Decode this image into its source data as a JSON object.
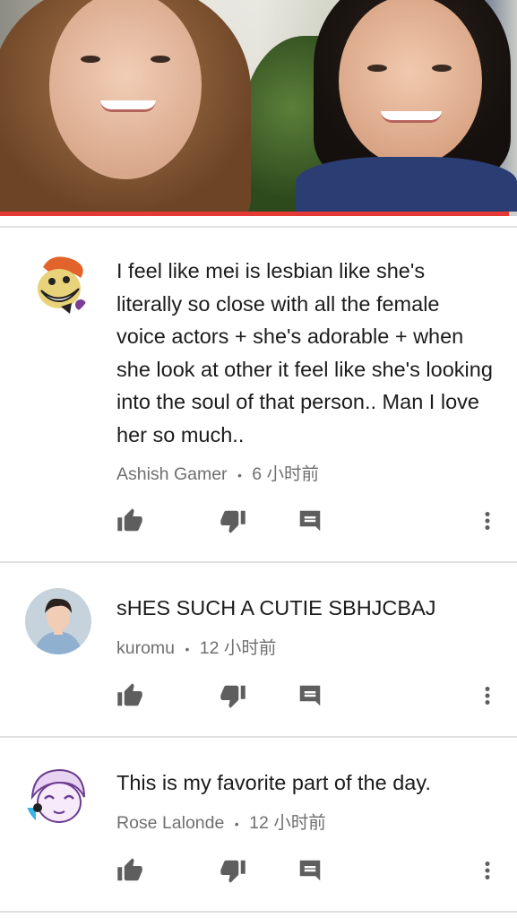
{
  "video": {
    "progress_percent": 98.5,
    "colors": {
      "progress": "#e53935",
      "track": "#cfcfcf"
    }
  },
  "comments": [
    {
      "text": "I feel like mei is lesbian like she's literally so close with all the female voice actors + she's adorable + when she look at other it feel like she's looking into the soul of that person.. Man I love her so much..",
      "author": "Ashish Gamer",
      "separator": "•",
      "time": "6 小时前",
      "avatar": "cartoon-face-avatar"
    },
    {
      "text": "sHES SUCH A CUTIE SBHJCBAJ",
      "author": "kuromu",
      "separator": "•",
      "time": "12 小时前",
      "avatar": "person-photo-avatar"
    },
    {
      "text": "This is my favorite part of the day.",
      "author": "Rose Lalonde",
      "separator": "•",
      "time": "12 小时前",
      "avatar": "anime-drawing-avatar"
    }
  ],
  "icons": {
    "like": "thumb-up-icon",
    "dislike": "thumb-down-icon",
    "reply": "comment-icon",
    "more": "more-vert-icon"
  }
}
